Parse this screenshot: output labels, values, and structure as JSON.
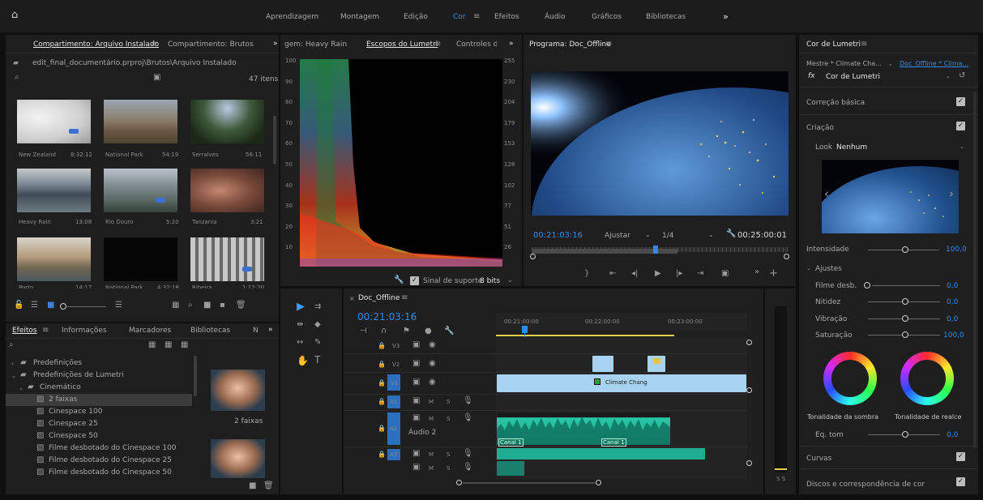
{
  "topbar": {
    "workspaces": [
      "Aprendizagem",
      "Montagem",
      "Edição",
      "Cor",
      "Efeitos",
      "Áudio",
      "Gráficos",
      "Bibliotecas"
    ],
    "active": "Cor",
    "more": "»"
  },
  "project": {
    "tab1": "Compartimento: Arquivo Instalado",
    "tab2": "Compartimento: Brutos",
    "path": "edit_final_documentário.prproj\\Brutos\\Arquivo Instalado",
    "count": "47 itens",
    "items": [
      {
        "name": "New Zealand",
        "dur": "8:32:12"
      },
      {
        "name": "National Park",
        "dur": "54:19"
      },
      {
        "name": "Serralves",
        "dur": "56:11"
      },
      {
        "name": "Heavy Rain",
        "dur": "13:08"
      },
      {
        "name": "Rio Douro",
        "dur": "5:20"
      },
      {
        "name": "Tanzania",
        "dur": "3:21"
      },
      {
        "name": "Porto",
        "dur": "14:17"
      },
      {
        "name": "National Park",
        "dur": "4:32:18"
      },
      {
        "name": "Ribeira",
        "dur": "1:12:20"
      }
    ]
  },
  "effects": {
    "tabs": [
      "Efeitos",
      "Informações",
      "Marcadores",
      "Bibliotecas",
      "N"
    ],
    "tree": [
      "Predefinições",
      "Predefinições de Lumetri",
      "Cinemático",
      "2 faixas",
      "Cinespace 100",
      "Cinespace 25",
      "Cinespace 50",
      "Filme desbotado do Cinespace 100",
      "Filme desbotado do Cinespace 25",
      "Filme desbotado do Cinespace 50"
    ],
    "preview_label": "2 faixas"
  },
  "scopes": {
    "tab_left": "gem: Heavy Rain",
    "tab_active": "Escopos do Lumetri",
    "tab_right": "Controles d",
    "scale_left": [
      "100",
      "90",
      "80",
      "70",
      "60",
      "50",
      "40",
      "30",
      "20",
      "10"
    ],
    "scale_right": [
      "255",
      "230",
      "204",
      "179",
      "153",
      "128",
      "102",
      "77",
      "51",
      "26"
    ],
    "support": "Sinal de suporte",
    "bits": "8 bits"
  },
  "program": {
    "title": "Programa: Doc_Offline",
    "timecode": "00:21:03:16",
    "fit": "Ajustar",
    "res": "1/4",
    "duration": "00:25:00:01"
  },
  "timeline": {
    "title": "Doc_Offline",
    "timecode": "00:21:03:16",
    "ruler": [
      "00:21:00:00",
      "00:22:00:00",
      "00:23:00:00"
    ],
    "tracks": [
      "V3",
      "V2",
      "V1",
      "A1",
      "A2",
      "A3"
    ],
    "audio2_name": "Áudio 2",
    "clip_name": "Climate Chang",
    "canal": "Canal 1",
    "level": "S S"
  },
  "lumetri": {
    "title": "Cor de Lumetri",
    "master": "Mestre * Climate Cha...",
    "seq": "Doc_Offline * Clima...",
    "fx": "Cor de Lumetri",
    "sections": {
      "basic": "Correção básica",
      "creative": "Criação",
      "curves": "Curvas",
      "wheels": "Discos e correspondência de cor"
    },
    "look_label": "Look",
    "look_value": "Nenhum",
    "intensity_label": "Intensidade",
    "intensity_value": "100,0",
    "adjust_label": "Ajustes",
    "sliders": [
      {
        "label": "Filme desb.",
        "value": "0,0"
      },
      {
        "label": "Nitidez",
        "value": "0,0"
      },
      {
        "label": "Vibração",
        "value": "0,0"
      },
      {
        "label": "Saturação",
        "value": "100,0"
      }
    ],
    "shadow_tint": "Tonalidade da sombra",
    "highlight_tint": "Tonalidade de realce",
    "tone_label": "Eq. tom",
    "tone_value": "0,0"
  }
}
